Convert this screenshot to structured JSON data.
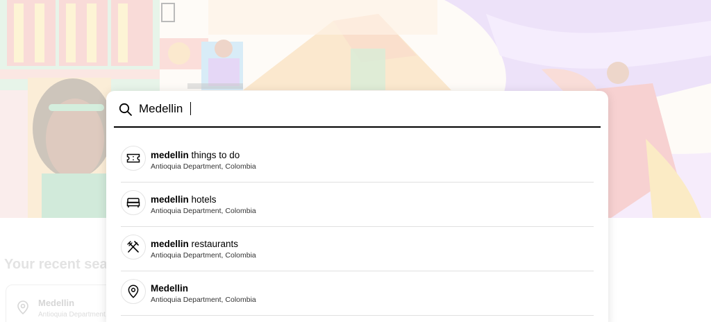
{
  "search": {
    "value": "Medellin",
    "placeholder": ""
  },
  "suggestions": [
    {
      "match": "medellin",
      "rest": " things to do",
      "location": "Antioquia Department, Colombia",
      "icon": "ticket-icon"
    },
    {
      "match": "medellin",
      "rest": " hotels",
      "location": "Antioquia Department, Colombia",
      "icon": "bed-icon"
    },
    {
      "match": "medellin",
      "rest": " restaurants",
      "location": "Antioquia Department, Colombia",
      "icon": "fork-knife-icon"
    },
    {
      "match": "Medellin",
      "rest": "",
      "location": "Antioquia Department, Colombia",
      "icon": "location-pin-icon"
    }
  ],
  "recent": {
    "title": "Your recent searches",
    "items": [
      {
        "name": "Medellin",
        "location": "Antioquia Department, Colombia"
      }
    ]
  },
  "colors": {
    "underline": "#000000",
    "divider": "#e0e0e0",
    "hero_bg": "#fdf6ee"
  }
}
